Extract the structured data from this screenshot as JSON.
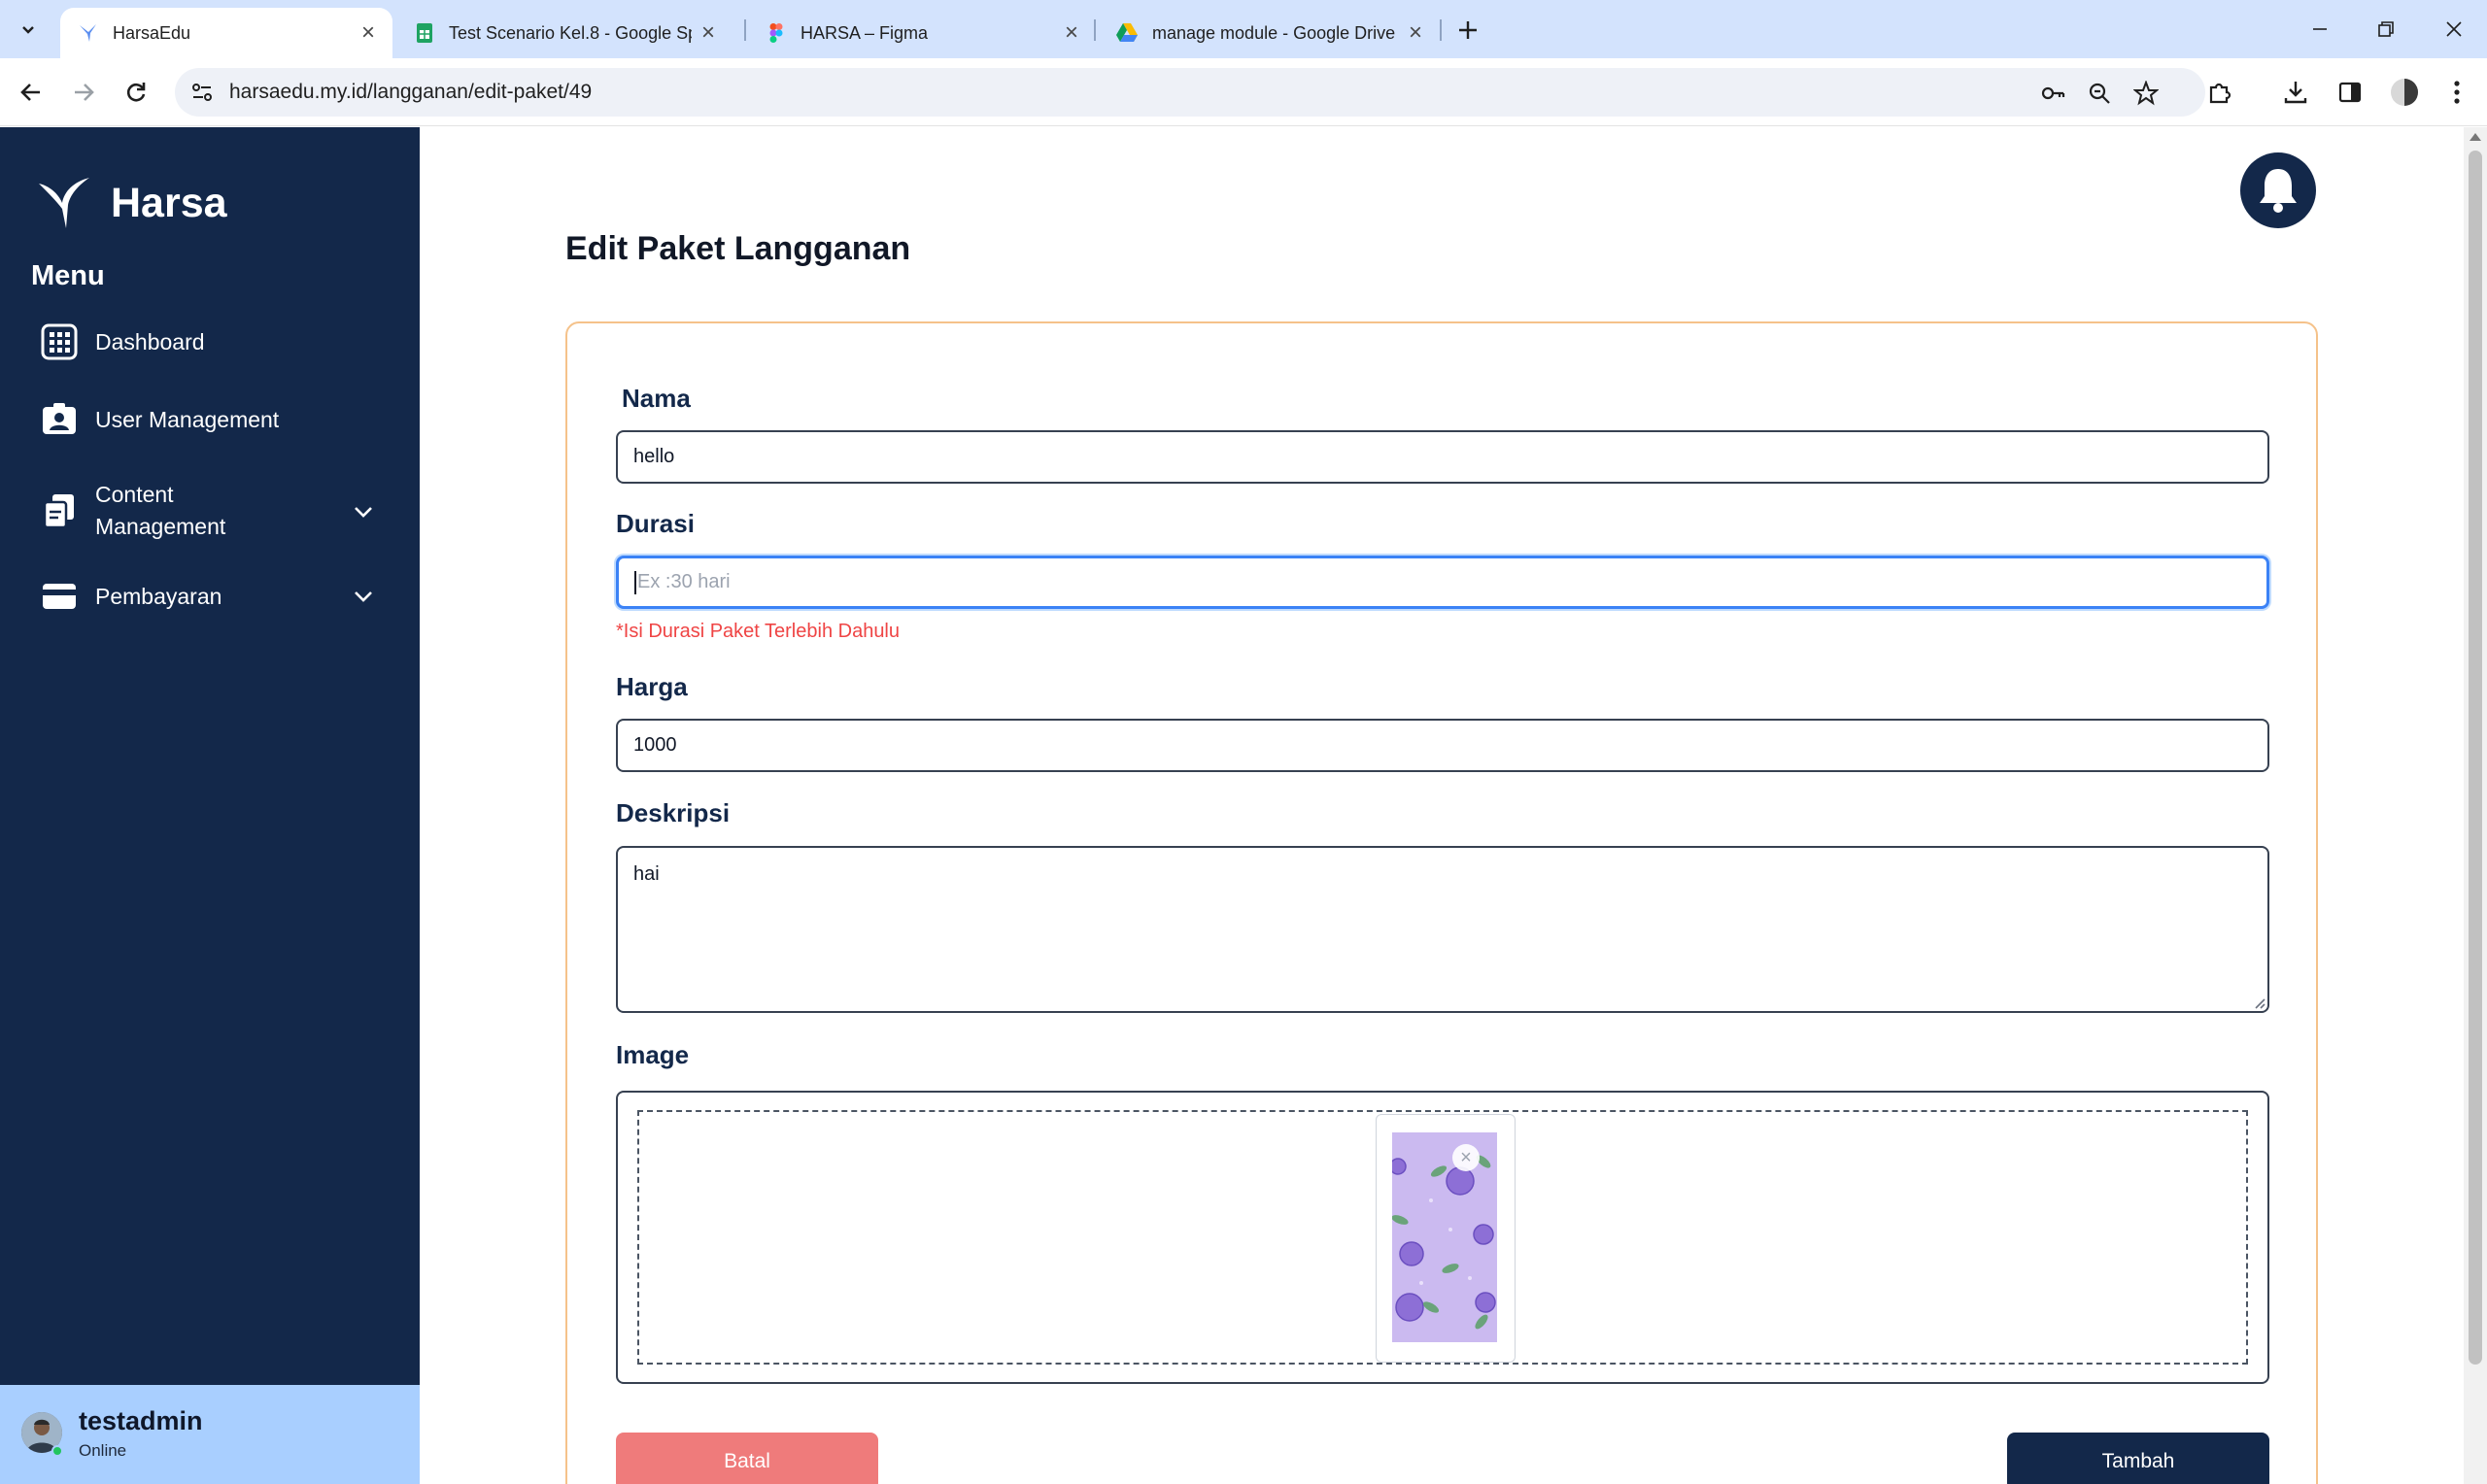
{
  "browser": {
    "tabs": [
      {
        "title": "HarsaEdu",
        "active": true,
        "icon": "harsa-logo-icon"
      },
      {
        "title": "Test Scenario Kel.8 - Google Sp",
        "active": false,
        "icon": "google-sheets-icon"
      },
      {
        "title": "HARSA – Figma",
        "active": false,
        "icon": "figma-icon"
      },
      {
        "title": "manage module - Google Drive",
        "active": false,
        "icon": "google-drive-icon"
      }
    ],
    "url": "harsaedu.my.id/langganan/edit-paket/49"
  },
  "sidebar": {
    "brand": "Harsa",
    "menu_title": "Menu",
    "items": [
      {
        "label": "Dashboard",
        "icon": "dashboard-grid-icon",
        "expandable": false
      },
      {
        "label": "User Management",
        "icon": "user-card-icon",
        "expandable": false
      },
      {
        "label_line1": "Content",
        "label_line2": "Management",
        "icon": "content-copy-icon",
        "expandable": true
      },
      {
        "label": "Pembayaran",
        "icon": "credit-card-icon",
        "expandable": true
      }
    ],
    "user": {
      "name": "testadmin",
      "status": "Online"
    }
  },
  "page": {
    "title": "Edit Paket Langganan",
    "form": {
      "nama": {
        "label": "Nama",
        "value": "hello"
      },
      "durasi": {
        "label": "Durasi",
        "value": "",
        "placeholder": "Ex :30 hari",
        "error": "*Isi Durasi Paket Terlebih Dahulu"
      },
      "harga": {
        "label": "Harga",
        "value": "1000"
      },
      "deskripsi": {
        "label": "Deskripsi",
        "value": "hai"
      },
      "image": {
        "label": "Image",
        "remove_symbol": "×"
      }
    },
    "buttons": {
      "cancel": "Batal",
      "submit": "Tambah"
    }
  },
  "colors": {
    "sidebar_bg": "#13284a",
    "accent_border": "#f5c28a",
    "cancel_button": "#ef7b7b",
    "submit_button": "#13284a",
    "error_text": "#ef4444",
    "user_card_bg": "#a9cfff"
  }
}
